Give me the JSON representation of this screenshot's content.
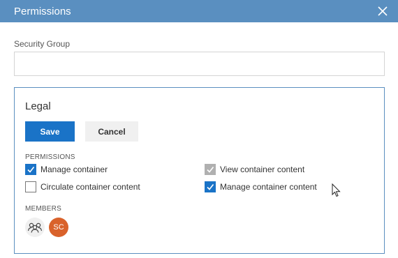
{
  "window": {
    "title": "Permissions",
    "close_icon": "close-icon"
  },
  "security_group": {
    "label": "Security Group",
    "value": "",
    "placeholder": ""
  },
  "group_panel": {
    "name": "Legal",
    "save_label": "Save",
    "cancel_label": "Cancel",
    "permissions_heading": "PERMISSIONS",
    "permissions": [
      {
        "label": "Manage container",
        "checked": true,
        "disabled": false
      },
      {
        "label": "View container content",
        "checked": true,
        "disabled": true
      },
      {
        "label": "Circulate container content",
        "checked": false,
        "disabled": false
      },
      {
        "label": "Manage container content",
        "checked": true,
        "disabled": false
      }
    ],
    "members_heading": "MEMBERS",
    "members": [
      {
        "type": "group",
        "icon": "group-icon"
      },
      {
        "type": "user",
        "initials": "SC"
      }
    ]
  },
  "colors": {
    "titlebar": "#5a8fc0",
    "primary_button": "#1a73c7",
    "checkbox_checked": "#1a73c7",
    "checkbox_disabled": "#b0b0b0",
    "avatar_user": "#d9622b"
  }
}
